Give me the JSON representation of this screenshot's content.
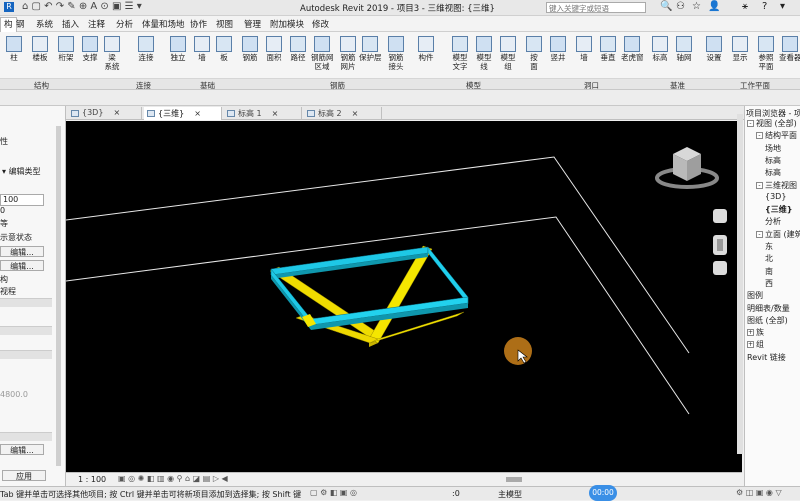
{
  "window": {
    "title": "Autodesk Revit 2019 - 项目3 - 三维视图: {三维}",
    "search_placeholder": "键入关键字或短语"
  },
  "menu": [
    "构",
    "钢",
    "系统",
    "插入",
    "注释",
    "分析",
    "体量和场地",
    "协作",
    "视图",
    "管理",
    "附加模块",
    "修改"
  ],
  "ribbon": {
    "tools": [
      {
        "label": "柱",
        "icon": "column-icon"
      },
      {
        "label": "楼板",
        "icon": "floor-icon"
      },
      {
        "label": "桁架",
        "icon": "truss-icon"
      },
      {
        "label": "支撑",
        "icon": "brace-icon"
      },
      {
        "label": "梁\n系统",
        "icon": "beam-system-icon"
      },
      {
        "label": "连接",
        "icon": "connection-icon"
      },
      {
        "label": "独立",
        "icon": "isolated-foundation-icon"
      },
      {
        "label": "墙",
        "icon": "wall-foundation-icon"
      },
      {
        "label": "板",
        "icon": "slab-foundation-icon"
      },
      {
        "label": "钢筋",
        "icon": "rebar-icon"
      },
      {
        "label": "面积",
        "icon": "area-rebar-icon"
      },
      {
        "label": "路径",
        "icon": "path-rebar-icon"
      },
      {
        "label": "钢筋网\n区域",
        "icon": "fabric-area-icon"
      },
      {
        "label": "钢筋\n网片",
        "icon": "fabric-sheet-icon"
      },
      {
        "label": "保护层",
        "icon": "cover-icon"
      },
      {
        "label": "钢筋\n接头",
        "icon": "coupler-icon"
      },
      {
        "label": "构件",
        "icon": "component-icon"
      },
      {
        "label": "模型\n文字",
        "icon": "model-text-icon"
      },
      {
        "label": "模型\n线",
        "icon": "model-line-icon"
      },
      {
        "label": "模型\n组",
        "icon": "model-group-icon"
      },
      {
        "label": "按\n面",
        "icon": "by-face-icon"
      },
      {
        "label": "竖井",
        "icon": "shaft-icon"
      },
      {
        "label": "墙",
        "icon": "wall-opening-icon"
      },
      {
        "label": "垂直",
        "icon": "vertical-opening-icon"
      },
      {
        "label": "老虎窗",
        "icon": "dormer-icon"
      },
      {
        "label": "标高",
        "icon": "level-icon"
      },
      {
        "label": "轴网",
        "icon": "grid-icon"
      },
      {
        "label": "设置",
        "icon": "set-workplane-icon"
      },
      {
        "label": "显示",
        "icon": "show-workplane-icon"
      },
      {
        "label": "参照\n平面",
        "icon": "ref-plane-icon"
      },
      {
        "label": "查看器",
        "icon": "viewer-icon"
      }
    ],
    "groups": [
      "结构",
      "连接",
      "基础",
      "钢筋",
      "模型",
      "洞口",
      "基准",
      "工作平面"
    ]
  },
  "tabs": [
    {
      "label": "{3D}",
      "active": false
    },
    {
      "label": "{三维}",
      "active": true
    },
    {
      "label": "标高 1",
      "active": false
    },
    {
      "label": "标高 2",
      "active": false
    }
  ],
  "properties": {
    "header": "性",
    "edit_type": "编辑类型",
    "rows": [
      "100",
      "0",
      "等",
      "示意状态",
      "编辑...",
      "编辑...",
      "构",
      "视程",
      "4800.0",
      "编辑..."
    ],
    "apply": "应用"
  },
  "project_browser": {
    "title": "项目浏览器 - 项目3",
    "items": [
      {
        "label": "视图 (全部)",
        "level": 0,
        "exp": "-"
      },
      {
        "label": "结构平面",
        "level": 1,
        "exp": "-"
      },
      {
        "label": "场地",
        "level": 2,
        "exp": ""
      },
      {
        "label": "标高",
        "level": 2,
        "exp": ""
      },
      {
        "label": "标高",
        "level": 2,
        "exp": ""
      },
      {
        "label": "三维视图",
        "level": 1,
        "exp": "-"
      },
      {
        "label": "{3D}",
        "level": 2,
        "exp": ""
      },
      {
        "label": "{三维}",
        "level": 2,
        "exp": "",
        "bold": true
      },
      {
        "label": "分析",
        "level": 2,
        "exp": ""
      },
      {
        "label": "立面 (建筑",
        "level": 1,
        "exp": "-"
      },
      {
        "label": "东",
        "level": 2,
        "exp": ""
      },
      {
        "label": "北",
        "level": 2,
        "exp": ""
      },
      {
        "label": "南",
        "level": 2,
        "exp": ""
      },
      {
        "label": "西",
        "level": 2,
        "exp": ""
      },
      {
        "label": "图例",
        "level": 0,
        "exp": ""
      },
      {
        "label": "明细表/数量",
        "level": 0,
        "exp": ""
      },
      {
        "label": "图纸 (全部)",
        "level": 0,
        "exp": ""
      },
      {
        "label": "族",
        "level": 0,
        "exp": "+"
      },
      {
        "label": "组",
        "level": 0,
        "exp": "+"
      },
      {
        "label": "Revit 链接",
        "level": 0,
        "exp": ""
      }
    ]
  },
  "viewbar": {
    "scale": "1 : 100"
  },
  "status": {
    "message": "Tab 键并单击可选择其他项目; 按 Ctrl 键并单击可将新项目添加到选择集; 按 Shift 键",
    "count": ":0",
    "model": "主模型",
    "timer": "00:00"
  },
  "colors": {
    "beam_cyan": "#1ec8e6",
    "brace_yellow": "#f5e600",
    "viewport_bg": "#000000",
    "cursor_highlight": "#c07a1a"
  }
}
